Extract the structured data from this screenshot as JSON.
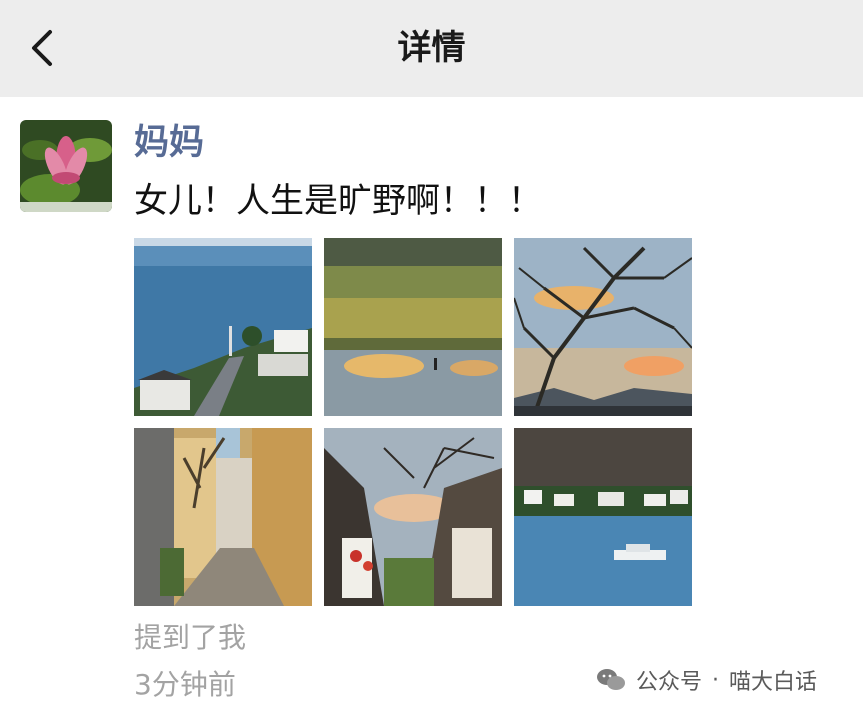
{
  "header": {
    "title": "详情",
    "back_icon": "chevron-left-icon"
  },
  "post": {
    "author": "妈妈",
    "text": "女儿！人生是旷野啊！！！",
    "photos": [
      "lake-village-photo",
      "wetland-reflection-photo",
      "tree-sunset-photo",
      "old-town-alley-photo",
      "courtyard-tree-photo",
      "lake-boat-photo"
    ],
    "mention": "提到了我",
    "time": "3分钟前"
  },
  "watermark": {
    "platform": "公众号",
    "separator": "·",
    "account": "喵大白话"
  },
  "colors": {
    "header_bg": "#ededed",
    "nickname": "#576b95",
    "meta_text": "#a3a3a3"
  }
}
